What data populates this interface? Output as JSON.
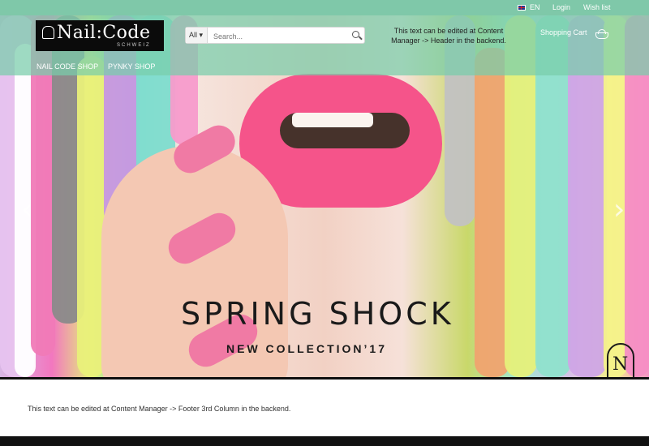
{
  "topbar": {
    "language": "EN",
    "login": "Login",
    "wishlist": "Wish list"
  },
  "header": {
    "logo_text": "Nail:Code",
    "logo_sub": "SCHWEIZ",
    "search": {
      "dropdown": "All",
      "placeholder": "Search..."
    },
    "header_text": "This text can be edited at Content Manager -> Header in the backend.",
    "cart_label": "Shopping Cart"
  },
  "nav": {
    "items": [
      {
        "label": "NAIL CODE SHOP"
      },
      {
        "label": "PYNKY SHOP"
      }
    ]
  },
  "hero": {
    "headline": "SPRING SHOCK",
    "subheadline": "NEW COLLECTION’17",
    "badge": "N",
    "slides": 6,
    "active_slide": 1
  },
  "footer": {
    "text": "This text can be edited at Content Manager -> Footer 3rd Column in the backend."
  },
  "colors": {
    "accent": "#7fc8a9",
    "lips": "#f5548a",
    "bottom_bar": "#111111"
  }
}
